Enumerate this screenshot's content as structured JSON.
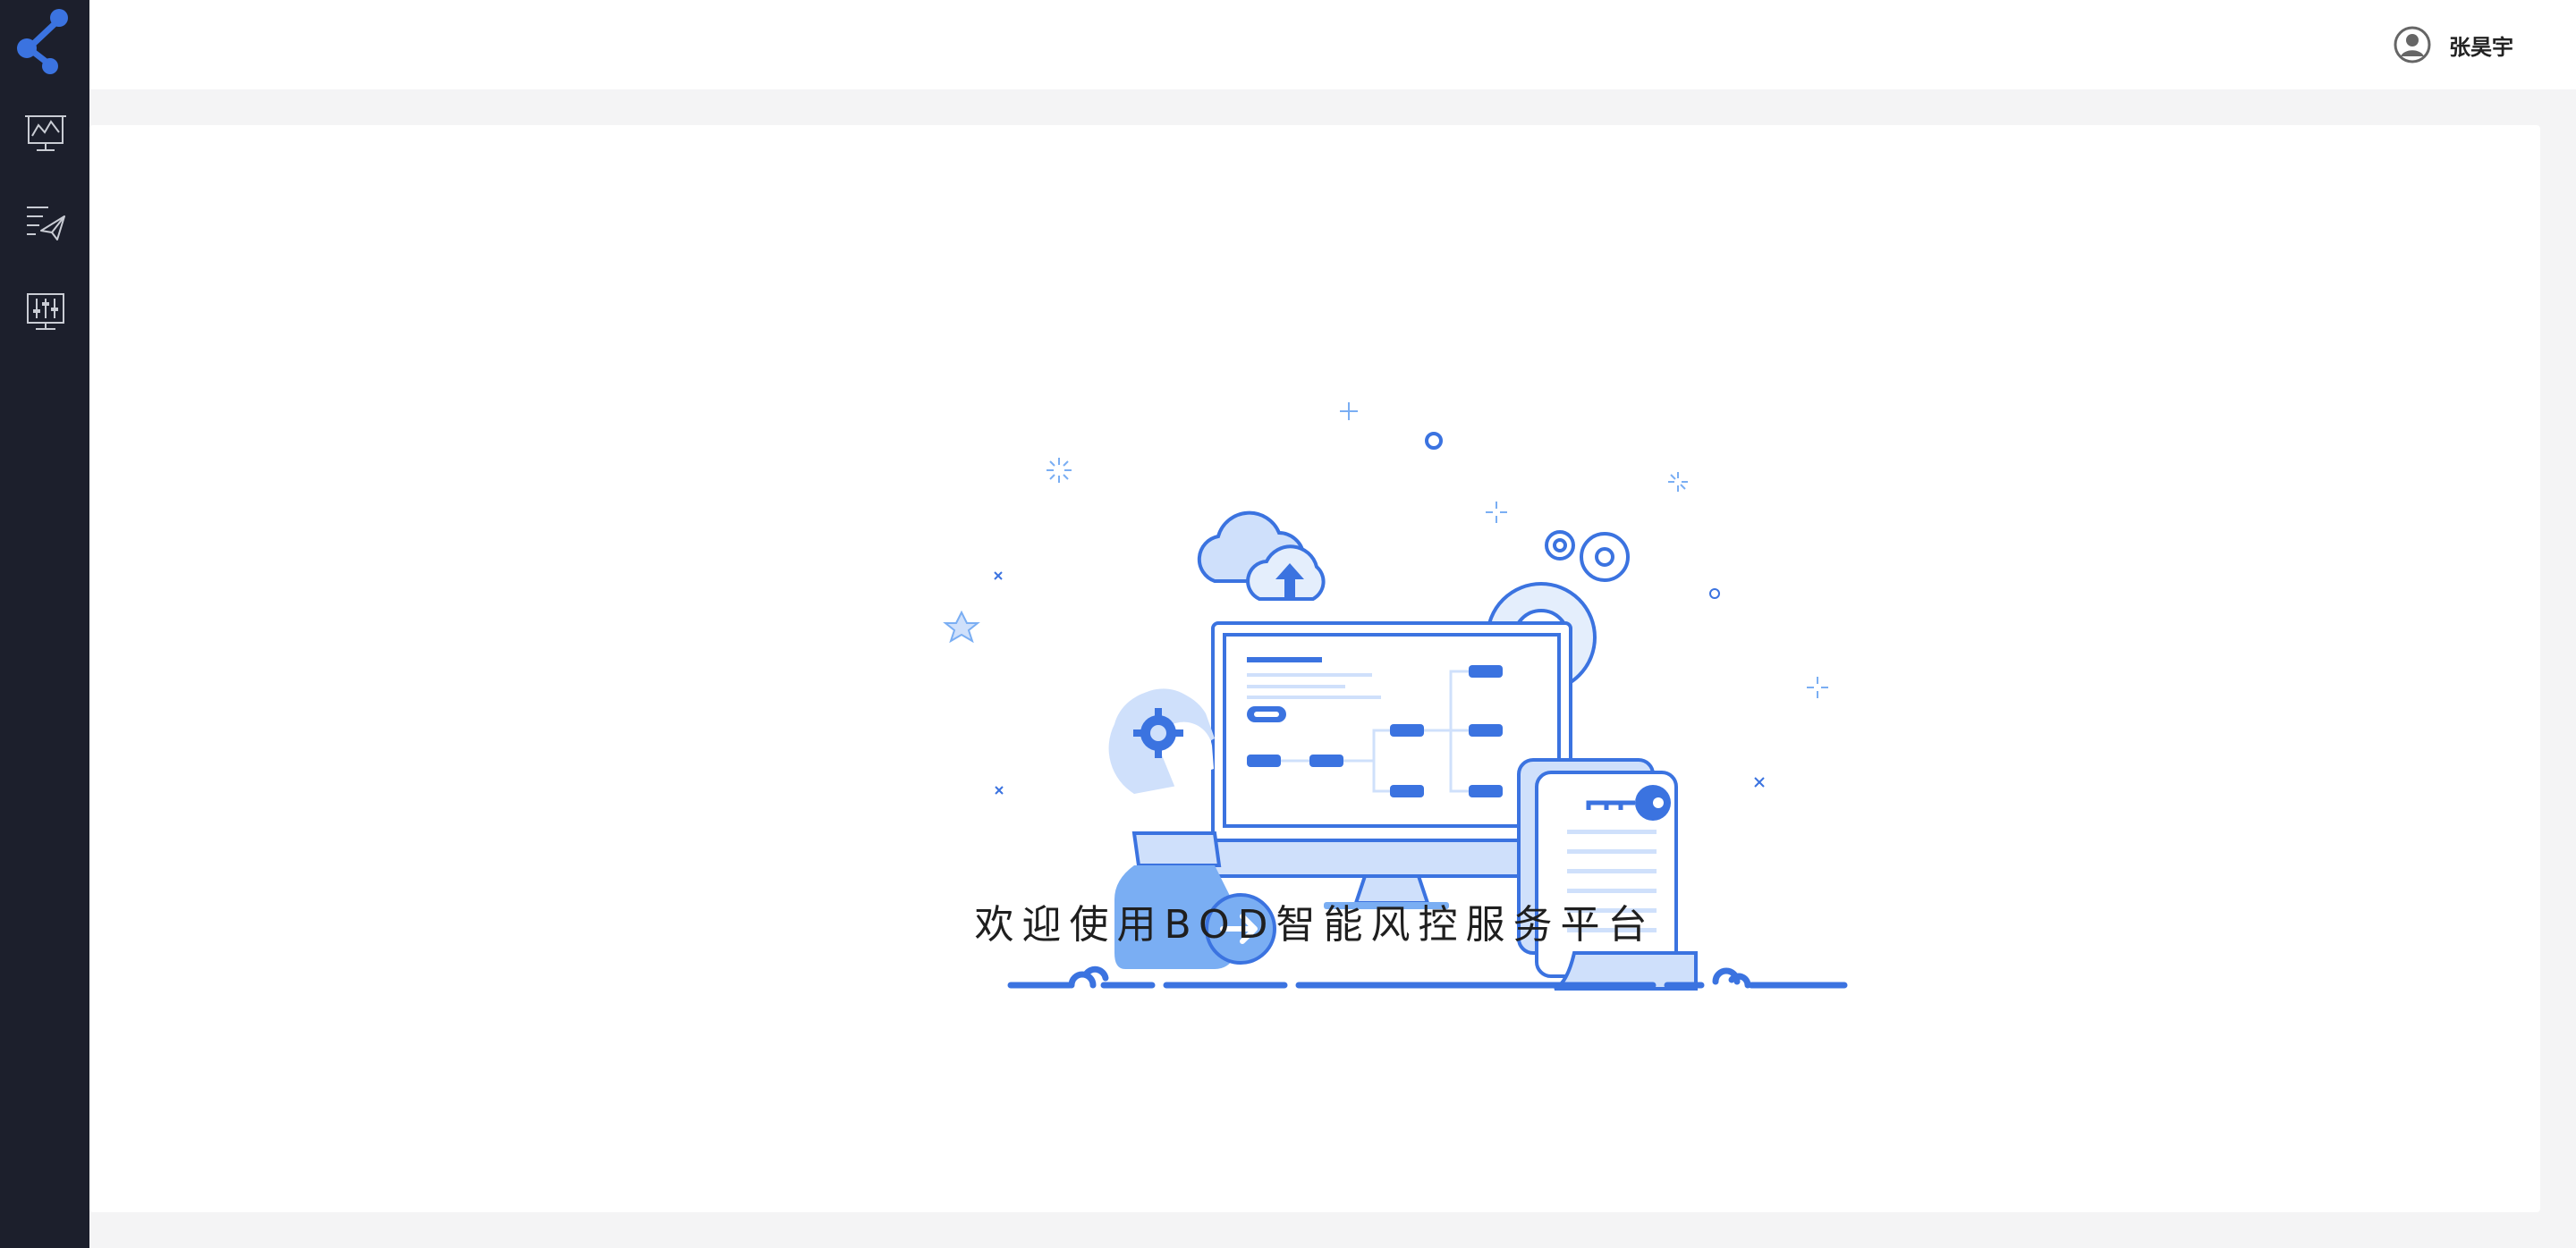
{
  "sidebar": {
    "logo_icon": "share-nodes-logo",
    "items": [
      {
        "id": "dashboard",
        "icon": "monitor-chart-icon"
      },
      {
        "id": "send",
        "icon": "list-send-icon"
      },
      {
        "id": "settings",
        "icon": "monitor-sliders-icon"
      }
    ]
  },
  "header": {
    "user_name": "张昊宇",
    "avatar_icon": "user-avatar-icon",
    "logout_icon": "power-icon"
  },
  "main": {
    "welcome_text": "欢迎使用BOD智能风控服务平台"
  },
  "colors": {
    "sidebar_bg": "#1c1f2c",
    "accent": "#3b73e0",
    "light_blue": "#cfe0fb",
    "mid_blue": "#7aaef3",
    "page_bg": "#f4f4f5"
  }
}
